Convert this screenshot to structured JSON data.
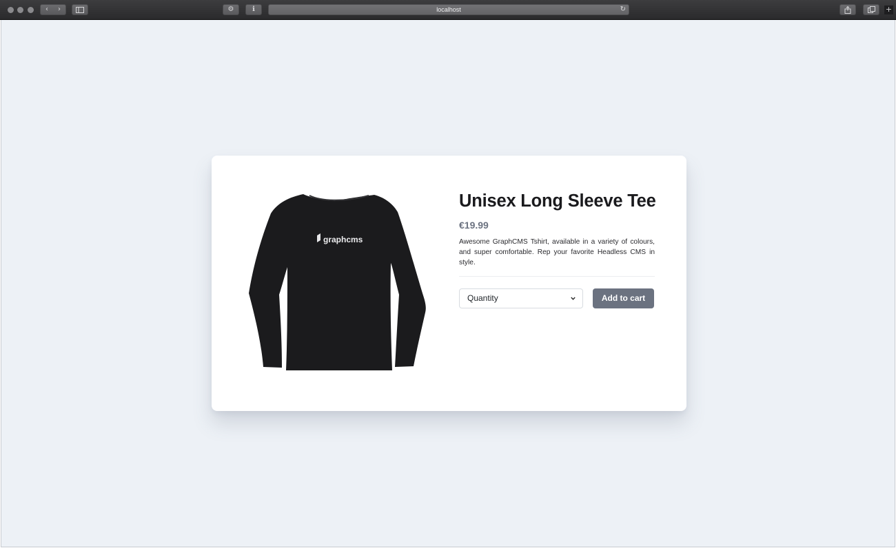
{
  "browser": {
    "url": "localhost",
    "icons": {
      "back": "chevron-left-icon",
      "forward": "chevron-right-icon",
      "sidebar": "sidebar-icon",
      "extension_1": "gear-icon",
      "extension_2": "info-icon",
      "reload": "reload-icon",
      "share": "share-icon",
      "tabs": "tabs-icon",
      "new_tab": "plus-icon"
    }
  },
  "product": {
    "image_alt": "black long sleeve tee",
    "image_logo_text": "graphcms",
    "title": "Unisex Long Sleeve Tee",
    "price": "€19.99",
    "description": "Awesome GraphCMS Tshirt, available in a variety of colours, and super comfortable. Rep your favorite Headless CMS in style.",
    "quantity_placeholder": "Quantity",
    "add_to_cart_label": "Add to cart"
  },
  "colors": {
    "page_background": "#edf1f6",
    "card_background": "#ffffff",
    "button_background": "#6b7280",
    "price_text": "#6b7280",
    "shirt": "#1b1b1d"
  }
}
